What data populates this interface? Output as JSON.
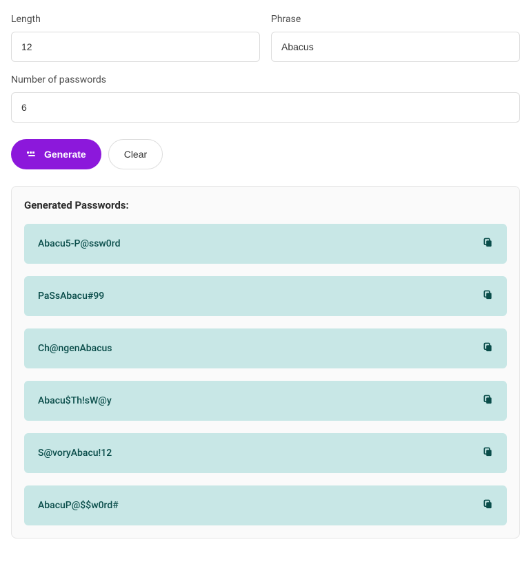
{
  "form": {
    "length": {
      "label": "Length",
      "value": "12"
    },
    "phrase": {
      "label": "Phrase",
      "value": "Abacus"
    },
    "count": {
      "label": "Number of passwords",
      "value": "6"
    }
  },
  "buttons": {
    "generate": "Generate",
    "clear": "Clear"
  },
  "results": {
    "title": "Generated Passwords:",
    "items": [
      "Abacu5-P@ssw0rd",
      "PaSsAbacu#99",
      "Ch@ngenAbacus",
      "Abacu$Th!sW@y",
      "S@voryAbacu!12",
      "AbacuP@$$w0rd#"
    ]
  }
}
